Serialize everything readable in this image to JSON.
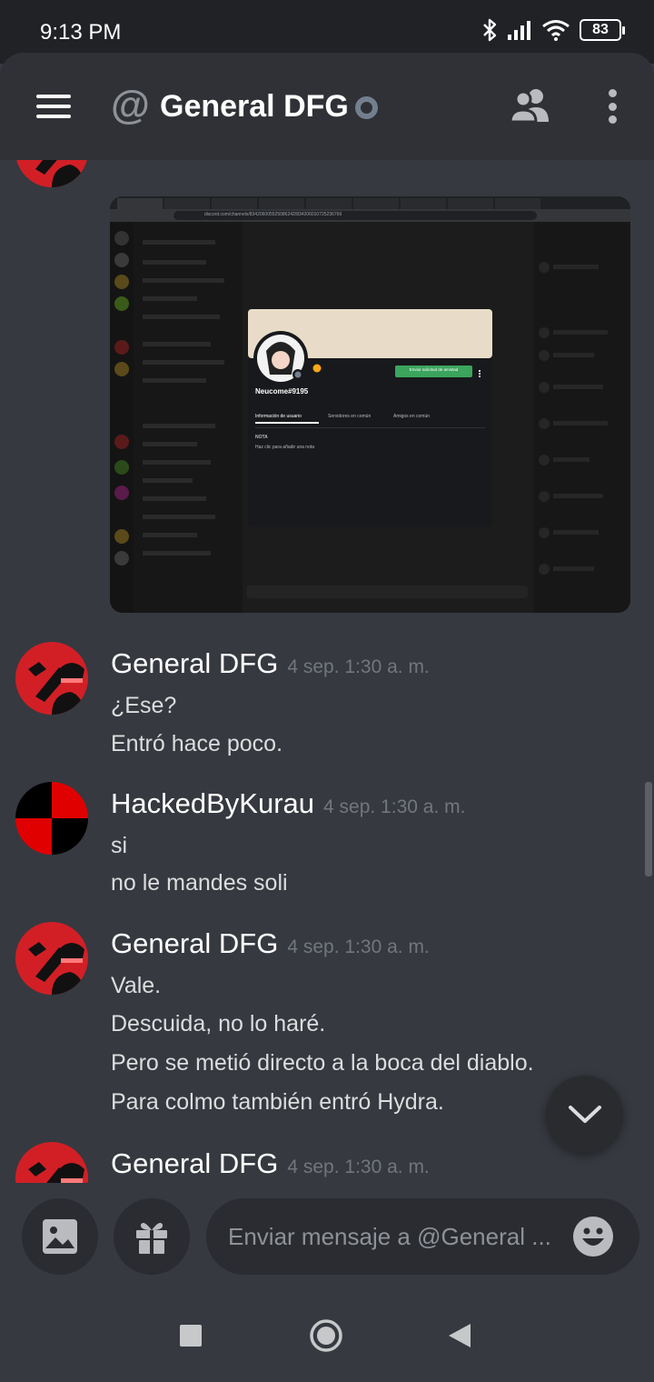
{
  "status_bar": {
    "time": "9:13 PM",
    "battery": "83",
    "icons": [
      "bluetooth-icon",
      "signal-icon",
      "wifi-icon",
      "battery-icon"
    ]
  },
  "header": {
    "title": "General DFG",
    "icons": [
      "menu-icon",
      "at-icon",
      "presence-offline-icon",
      "friends-icon",
      "more-vertical-icon"
    ]
  },
  "attachment": {
    "profile_username": "Neucome#9195",
    "add_friend_label": "Enviar solicitud de amistad",
    "tabs": [
      "Información de usuario",
      "Servidores en común",
      "Amigos en común"
    ],
    "note_heading": "NOTA",
    "note_placeholder": "Haz clic para añadir una nota",
    "url": "discord.com/channels/834206005525086242/834206010725236766"
  },
  "messages": [
    {
      "author": "General DFG",
      "time": "4 sep. 1:30 a. m.",
      "lines": [
        "¿Ese?",
        "Entró hace poco."
      ]
    },
    {
      "author": "HackedByKurau",
      "time": "4 sep. 1:30 a. m.",
      "lines": [
        "si",
        "no le mandes soli"
      ]
    },
    {
      "author": "General DFG",
      "time": "4 sep. 1:30 a. m.",
      "lines": [
        "Vale.",
        "Descuida, no lo haré.",
        "Pero se metió directo a la boca del diablo.",
        "Para colmo también entró Hydra."
      ]
    },
    {
      "author": "General DFG",
      "time": "4 sep. 1:30 a. m.",
      "lines": []
    }
  ],
  "composer": {
    "placeholder": "Enviar mensaje a @General ...",
    "icons": [
      "image-icon",
      "gift-icon",
      "emoji-icon"
    ]
  },
  "colors": {
    "background": "#36393f",
    "header": "#2f3136",
    "status_bar": "#202225",
    "dfg_avatar": "#d21f26",
    "kurau_avatar_a": "#e00000",
    "kurau_avatar_b": "#000000"
  },
  "nav_icons": [
    "recents-square-icon",
    "home-circle-icon",
    "back-triangle-icon"
  ]
}
